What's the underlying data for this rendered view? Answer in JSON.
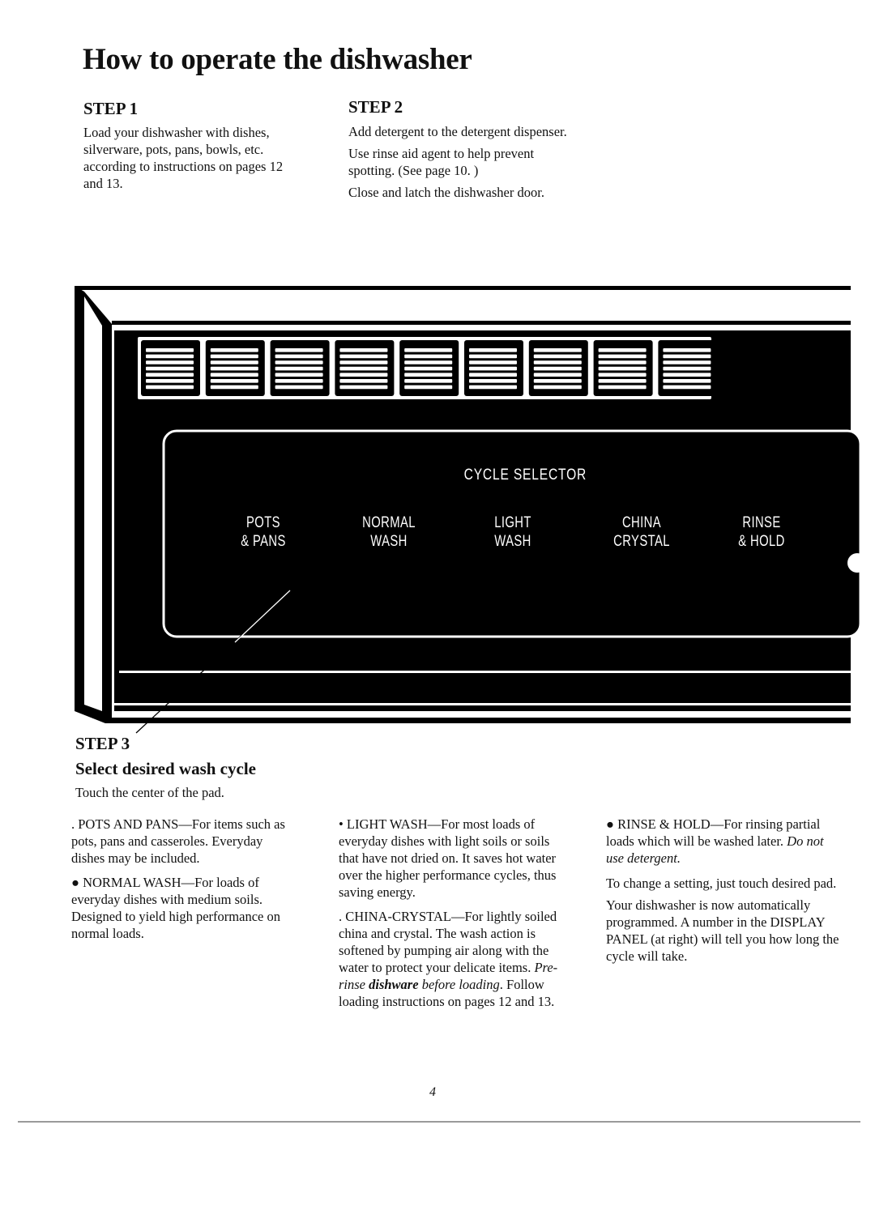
{
  "page": {
    "title": "How to operate the dishwasher",
    "page_number": "4"
  },
  "step1": {
    "heading": "STEP 1",
    "paragraphs": [
      "Load your dishwasher with dishes, silverware, pots, pans, bowls, etc. according to instructions on pages 12 and 13."
    ]
  },
  "step2": {
    "heading": "STEP 2",
    "paragraphs": [
      "Add detergent to the detergent dispenser.",
      "Use rinse aid agent to help prevent spotting. (See page 10. )",
      "Close and latch the dishwasher door."
    ]
  },
  "control_panel": {
    "cycle_selector_label": "CYCLE SELECTOR",
    "indicator_lights": 9,
    "pads": [
      {
        "line1": "POTS",
        "line2": "& PANS"
      },
      {
        "line1": "NORMAL",
        "line2": "WASH"
      },
      {
        "line1": "LIGHT",
        "line2": "WASH"
      },
      {
        "line1": "CHINA",
        "line2": "CRYSTAL"
      },
      {
        "line1": "RINSE",
        "line2": "& HOLD"
      }
    ],
    "colors": {
      "panel": "#000000",
      "trim": "#ffffff"
    }
  },
  "step3": {
    "heading": "STEP 3",
    "subheading": "Select desired wash cycle",
    "intro": "Touch the center of the pad.",
    "pots_pans": {
      "bullet": ". ",
      "name": "POTS AND PANS",
      "text": "—For items such as pots, pans and casseroles. Everyday dishes may be included."
    },
    "normal_wash": {
      "bullet": "● ",
      "name": "NORMAL WASH",
      "text": "—For loads of everyday dishes with medium soils. Designed to yield high performance on normal loads."
    },
    "light_wash": {
      "bullet": "• ",
      "name": "LIGHT WASH",
      "text": "—For most loads of everyday dishes with light soils or soils that have not dried on. It saves hot water over the higher performance cycles, thus saving energy."
    },
    "china_crystal": {
      "bullet": ". ",
      "name": "CHINA-CRYSTAL",
      "text": "—For lightly soiled china and crystal. The wash action is softened by pumping air along with the water to protect your delicate items. ",
      "italic1": "Pre-rinse ",
      "bold_italic": "dishware",
      "italic2": " before loading",
      "text2": ". Follow loading instructions on pages 12 and 13."
    },
    "rinse_hold": {
      "bullet": "● ",
      "name": "RINSE & HOLD",
      "text": "—For rinsing partial loads which will be washed later. ",
      "italic": "Do not use detergent."
    },
    "change_setting": "To change a setting, just touch desired pad.",
    "auto_programmed": "Your dishwasher is now automatically programmed. A number in the DISPLAY PANEL (at right) will tell you how long the cycle will take."
  }
}
